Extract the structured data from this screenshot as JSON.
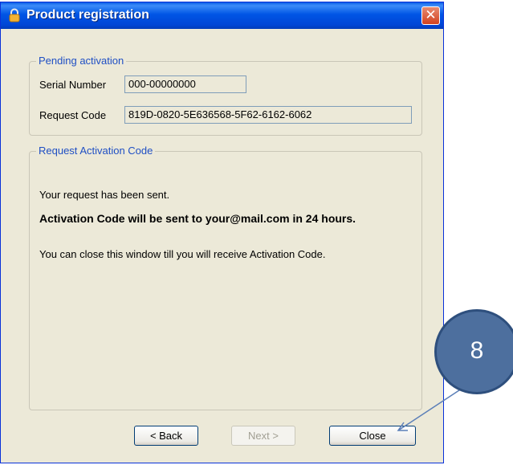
{
  "window": {
    "title": "Product registration",
    "close_glyph": "✕"
  },
  "pending": {
    "legend": "Pending activation",
    "serial_label": "Serial Number",
    "serial_value": "000-00000000",
    "request_label": "Request Code",
    "request_value": "819D-0820-5E636568-5F62-6162-6062"
  },
  "request": {
    "legend": "Request Activation Code",
    "line1": "Your request has been sent.",
    "line2": "Activation Code will be sent to your@mail.com in 24 hours.",
    "line3": "You can close this window till you will receive Activation Code."
  },
  "buttons": {
    "back_label": "< Back",
    "next_label": "Next >",
    "close_label": "Close"
  },
  "callout": {
    "number": "8"
  },
  "colors": {
    "titlebar": "#0055E5",
    "dialog_bg": "#ECE9D8",
    "legend_text": "#1F4FC4",
    "callout_fill": "#4D6F9E"
  },
  "icons": {
    "title_icon": "lock-icon"
  }
}
